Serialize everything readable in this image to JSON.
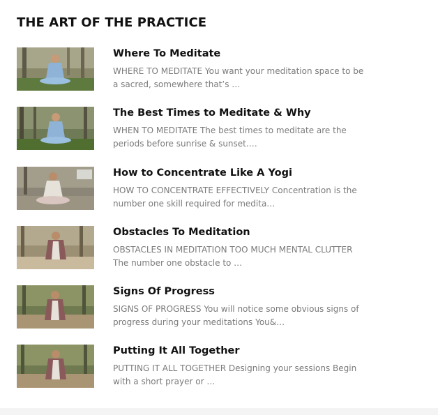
{
  "section": {
    "title": "THE ART OF THE PRACTICE"
  },
  "articles": [
    {
      "title": "Where To Meditate",
      "excerpt": "WHERE TO MEDITATE   You want your meditation space to be a sacred, somewhere that’s …",
      "thumbnail_icon": "man-meditating-forest-thumbnail"
    },
    {
      "title": "The Best Times to Meditate & Why",
      "excerpt": "WHEN TO MEDITATE   The best times to meditate are the periods before sunrise & sunset.…",
      "thumbnail_icon": "man-meditating-forest-thumbnail"
    },
    {
      "title": "How to Concentrate Like A Yogi",
      "excerpt": "HOW TO CONCENTRATE EFFECTIVELY   Concentration is the number one skill required for medita…",
      "thumbnail_icon": "man-seated-teaching-thumbnail"
    },
    {
      "title": "Obstacles To Meditation",
      "excerpt": "OBSTACLES IN MEDITATION   TOO MUCH MENTAL CLUTTER   The number one obstacle to …",
      "thumbnail_icon": "man-with-shawl-thumbnail"
    },
    {
      "title": "Signs Of Progress",
      "excerpt": "SIGNS OF PROGRESS You will notice some obvious signs of progress during your meditations You&…",
      "thumbnail_icon": "man-with-shawl-thumbnail"
    },
    {
      "title": "Putting It All Together",
      "excerpt": "PUTTING IT ALL TOGETHER   Designing your sessions   Begin with a short prayer or …",
      "thumbnail_icon": "man-with-shawl-thumbnail"
    }
  ]
}
